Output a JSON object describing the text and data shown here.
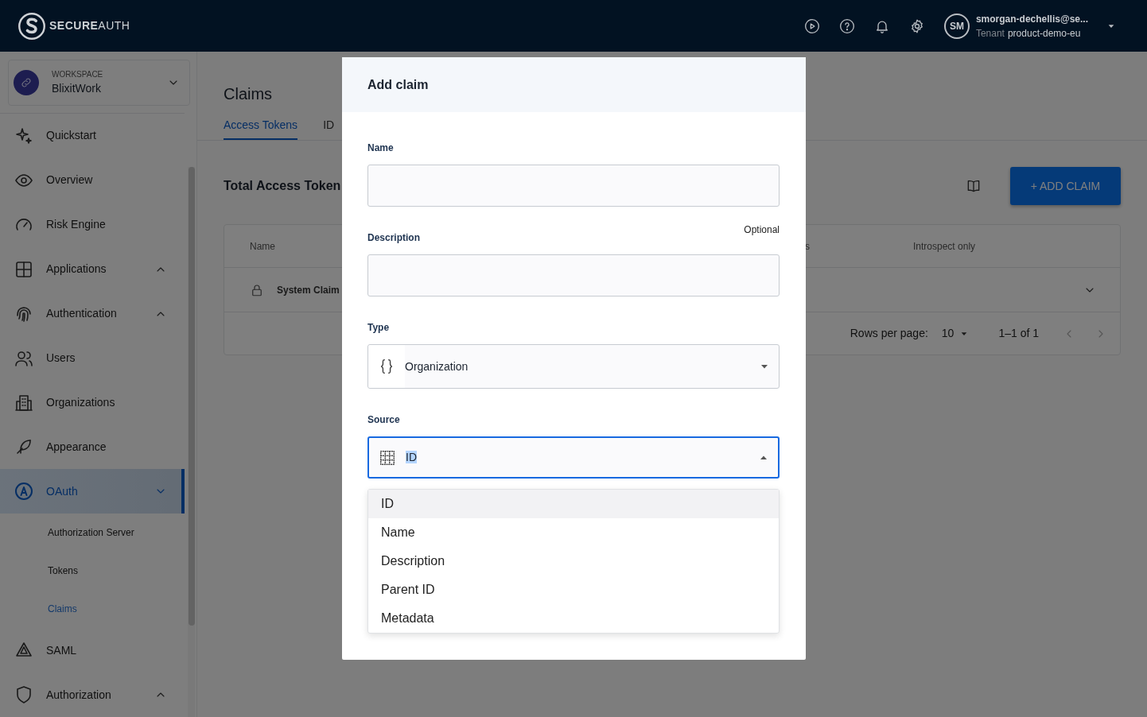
{
  "header": {
    "brand_bold": "SECURE",
    "brand_light": "AUTH",
    "user": {
      "initials": "SM",
      "email": "smorgan-dechellis@se...",
      "tenant_label": "Tenant",
      "tenant": "product-demo-eu"
    }
  },
  "workspace": {
    "label": "WORKSPACE",
    "name": "BlixitWork"
  },
  "sidebar": {
    "items": [
      {
        "kind": "link",
        "label": "Quickstart",
        "selected": false
      },
      {
        "kind": "link",
        "label": "Overview",
        "selected": false
      },
      {
        "kind": "link",
        "label": "Risk Engine",
        "selected": false
      },
      {
        "kind": "group",
        "label": "Applications",
        "selected": false,
        "expanded": false
      },
      {
        "kind": "group",
        "label": "Authentication",
        "selected": false,
        "expanded": false
      },
      {
        "kind": "link",
        "label": "Users",
        "selected": false
      },
      {
        "kind": "link",
        "label": "Organizations",
        "selected": false
      },
      {
        "kind": "link",
        "label": "Appearance",
        "selected": false
      },
      {
        "kind": "group",
        "label": "OAuth",
        "selected": true,
        "expanded": true,
        "children": [
          {
            "label": "Authorization Server",
            "selected": false
          },
          {
            "label": "Tokens",
            "selected": false
          },
          {
            "label": "Claims",
            "selected": true
          }
        ]
      },
      {
        "kind": "link",
        "label": "SAML",
        "selected": false
      },
      {
        "kind": "group",
        "label": "Authorization",
        "selected": false,
        "expanded": false
      }
    ]
  },
  "main": {
    "title": "Claims",
    "tabs": [
      {
        "label": "Access Tokens",
        "selected": true
      },
      {
        "label": "ID",
        "selected": false
      }
    ],
    "section_title": "Total Access Token",
    "add_button": "+ ADD CLAIM",
    "table": {
      "columns": [
        "Name",
        "s",
        "Introspect only"
      ],
      "rows": [
        {
          "name": "System Claim",
          "locked": true,
          "expanded": false
        }
      ],
      "pagination": {
        "rows_per_page_label": "Rows per page:",
        "rows_per_page": "10",
        "range": "1–1 of 1"
      }
    }
  },
  "modal": {
    "title": "Add claim",
    "fields": [
      {
        "kind": "text",
        "label": "Name"
      },
      {
        "kind": "text",
        "label": "Description",
        "hint": "Optional"
      },
      {
        "kind": "select",
        "label": "Type",
        "value": "Organization",
        "expanded": false,
        "focused": false
      },
      {
        "kind": "select",
        "label": "Source",
        "value": "ID",
        "expanded": true,
        "focused": true,
        "options": [
          {
            "label": "ID",
            "selected": true
          },
          {
            "label": "Name",
            "selected": false
          },
          {
            "label": "Description",
            "selected": false
          },
          {
            "label": "Parent ID",
            "selected": false
          },
          {
            "label": "Metadata",
            "selected": false
          }
        ]
      }
    ]
  }
}
